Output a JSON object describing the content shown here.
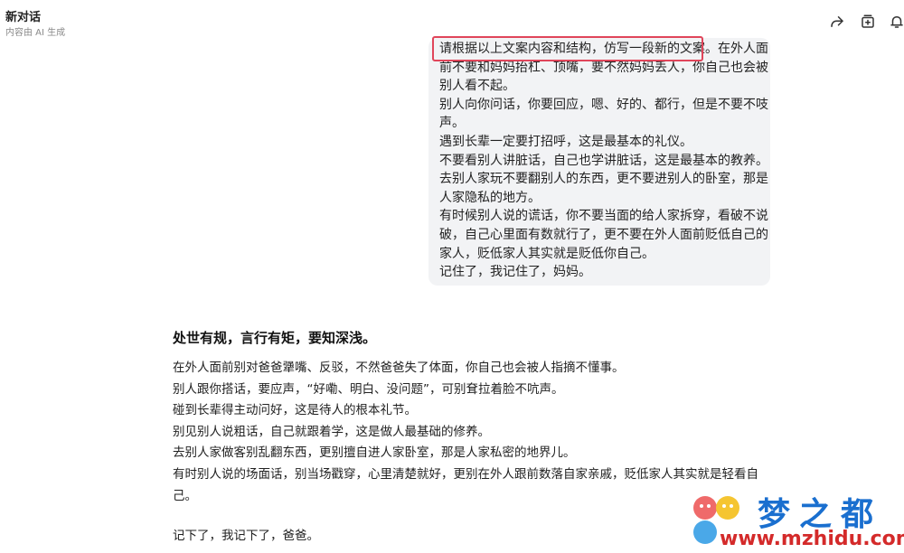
{
  "header": {
    "title": "新对话",
    "subtitle": "内容由 AI 生成",
    "icons": [
      "share-icon",
      "new-chat-icon",
      "bell-icon"
    ]
  },
  "user_message": {
    "lines": [
      "请根据以上文案内容和结构，仿写一段新的文案。在外人面",
      "前不要和妈妈抬杠、顶嘴，要不然妈妈丢人，你自己也会被",
      "别人看不起。",
      "别人向你问话，你要回应，嗯、好的、都行，但是不要不吱",
      "声。",
      "遇到长辈一定要打招呼，这是最基本的礼仪。",
      "不要看别人讲脏话，自己也学讲脏话，这是最基本的教养。",
      "去别人家玩不要翻别人的东西，更不要进别人的卧室，那是",
      "人家隐私的地方。",
      "有时候别人说的谎话，你不要当面的给人家拆穿，看破不说",
      "破，自己心里面有数就行了，更不要在外人面前贬低自己的",
      "家人，贬低家人其实就是贬低你自己。",
      "记住了，我记住了，妈妈。"
    ]
  },
  "answer": {
    "heading": "处世有规，言行有矩，要知深浅。",
    "lines": [
      "在外人面前别对爸爸犟嘴、反驳，不然爸爸失了体面，你自己也会被人指摘不懂事。",
      "别人跟你搭话，要应声，“好嘞、明白、没问题”，可别耷拉着脸不吭声。",
      "碰到长辈得主动问好，这是待人的根本礼节。",
      "别见别人说粗话，自己就跟着学，这是做人最基础的修养。",
      "去别人家做客别乱翻东西，更别擅自进人家卧室，那是人家私密的地界儿。",
      "有时别人说的场面话，别当场戳穿，心里清楚就好，更别在外人跟前数落自家亲戚，贬低家人其实就是轻看自",
      "己。"
    ],
    "footer": "记下了，我记下了，爸爸。"
  },
  "watermark": {
    "brand": "梦之都",
    "url": "www.mzhidu.com"
  },
  "colors": {
    "bubble_bg": "#f2f3f5",
    "highlight": "#e0455a",
    "brand_blue": "#1a6fcf",
    "brand_red": "#d42a2a"
  }
}
